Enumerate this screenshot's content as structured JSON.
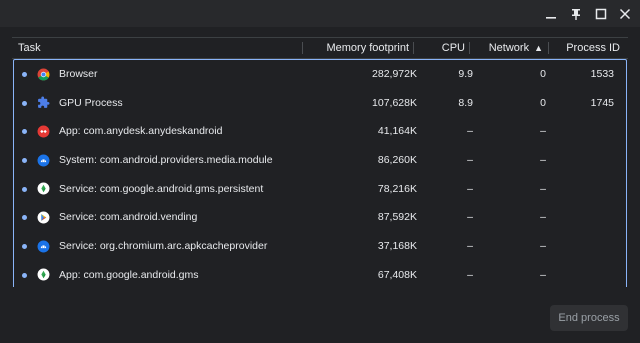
{
  "window": {
    "minimize_icon": "minimize-icon",
    "pin_icon": "pin-icon",
    "maximize_icon": "maximize-icon",
    "close_icon": "close-icon"
  },
  "columns": {
    "task": "Task",
    "memory": "Memory footprint",
    "cpu": "CPU",
    "network": "Network",
    "network_sort": "▲",
    "pid": "Process ID"
  },
  "rows": [
    {
      "icon": "chrome-icon",
      "task": "Browser",
      "memory": "282,972K",
      "cpu": "9.9",
      "network": "0",
      "pid": "1533"
    },
    {
      "icon": "puzzle-icon",
      "task": "GPU Process",
      "memory": "107,628K",
      "cpu": "8.9",
      "network": "0",
      "pid": "1745"
    },
    {
      "icon": "anydesk-icon",
      "task": "App: com.anydesk.anydeskandroid",
      "memory": "41,164K",
      "cpu": "–",
      "network": "–",
      "pid": ""
    },
    {
      "icon": "android-system-icon",
      "task": "System: com.android.providers.media.module",
      "memory": "86,260K",
      "cpu": "–",
      "network": "–",
      "pid": ""
    },
    {
      "icon": "play-services-icon",
      "task": "Service: com.google.android.gms.persistent",
      "memory": "78,216K",
      "cpu": "–",
      "network": "–",
      "pid": ""
    },
    {
      "icon": "play-store-icon",
      "task": "Service: com.android.vending",
      "memory": "87,592K",
      "cpu": "–",
      "network": "–",
      "pid": ""
    },
    {
      "icon": "android-system-icon",
      "task": "Service: org.chromium.arc.apkcacheprovider",
      "memory": "37,168K",
      "cpu": "–",
      "network": "–",
      "pid": ""
    },
    {
      "icon": "play-services-icon",
      "task": "App: com.google.android.gms",
      "memory": "67,408K",
      "cpu": "–",
      "network": "–",
      "pid": ""
    }
  ],
  "end_process_label": "End process",
  "colors": {
    "background": "#202124",
    "accent": "#8ab4f8",
    "disabled_button": "#303134"
  }
}
